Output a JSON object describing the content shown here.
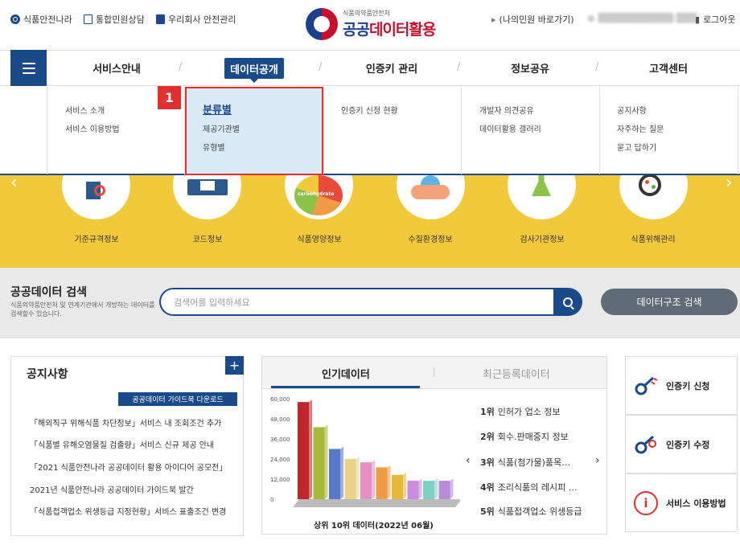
{
  "top_links": [
    "식품안전나라",
    "통합민원상담",
    "우리회사 안전관리"
  ],
  "logo": {
    "subtitle": "식품의약품안전처",
    "title_a": "공공",
    "title_b": "데이터활용"
  },
  "user_links": {
    "my_complaint": "(나의민원 바로가기)",
    "user_name": "███████████(███)",
    "login": "로그아웃"
  },
  "nav": {
    "items": [
      "서비스안내",
      "데이터공개",
      "인증키 관리",
      "정보공유",
      "고객센터"
    ],
    "active": "데이터공개"
  },
  "dropdown": {
    "service": [
      "서비스 소개",
      "서비스 이용방법"
    ],
    "data_open": [
      "분류별",
      "제공기관별",
      "유형별"
    ],
    "key_mgmt": [
      "인증키 신청 현황"
    ],
    "info_share": [
      "개발자 의견공유",
      "데이터활용 갤러리"
    ],
    "customer": [
      "공지사항",
      "자주하는 질문",
      "묻고 답하기"
    ],
    "badge": "1"
  },
  "banner": {
    "items": [
      "기준규격정보",
      "코드정보",
      "식품영양정보",
      "수질환경정보",
      "검사기관정보",
      "식품위해관리"
    ],
    "pie_label": "carbohydrate"
  },
  "search": {
    "title": "공공데이터 검색",
    "desc": "식품의약품안전처 및 연계기관에서 개방하는 데이터를 검색할수 있습니다.",
    "placeholder": "검색어를 입력하세요",
    "struct_btn": "데이터구조 검색"
  },
  "notice": {
    "title": "공지사항",
    "plus": "+",
    "guide_btn": "공공데이터 가이드북 다운로드",
    "items": [
      "「해외직구 위해식품 차단정보」서비스 내 조회조건 추가",
      "「식품별 유해오염물질 검출량」서비스 신규 제공 안내",
      "「2021 식품안전나라 공공데이터 활용 아이디어 공모전」",
      "2021년 식품안전나라 공공데이터 가이드북 발간",
      "「식품접객업소 위생등급 지정현황」서비스 표출조건 변경"
    ]
  },
  "popular": {
    "tabs": [
      "인기데이터",
      "최근등록데이터"
    ],
    "caption": "상위 10위 데이터(2022년 06월)",
    "ranks": [
      {
        "rank": "1위",
        "label": "인허가 업소 정보"
      },
      {
        "rank": "2위",
        "label": "회수.판매중지 정보"
      },
      {
        "rank": "3위",
        "label": "식품(첨가물)품목제조보고"
      },
      {
        "rank": "4위",
        "label": "조리식품의 레시피 DB"
      },
      {
        "rank": "5위",
        "label": "식품접객업소 위생등급"
      }
    ]
  },
  "chart_data": {
    "type": "bar",
    "categories": [
      "1",
      "2",
      "3",
      "4",
      "5",
      "6",
      "7",
      "8",
      "9",
      "10"
    ],
    "values": [
      58000,
      43000,
      30000,
      24000,
      22000,
      19000,
      14500,
      11000,
      11000,
      11000
    ],
    "colors": [
      "#c0272d",
      "#a8b83a",
      "#5a78c8",
      "#e9d28a",
      "#e88fc2",
      "#f29b46",
      "#e8b83a",
      "#c88de0",
      "#7fd0c4",
      "#b78bd8"
    ],
    "yticks": [
      "0",
      "12,000",
      "24,000",
      "36,000",
      "48,000",
      "60,000"
    ],
    "ylim": [
      0,
      60000
    ]
  },
  "cards": [
    "인증키 신청",
    "인증키 수정",
    "서비스 이용방법"
  ],
  "colors": {
    "primary": "#1a4a8a",
    "accent": "#e03030",
    "banner": "#f1c93a"
  }
}
